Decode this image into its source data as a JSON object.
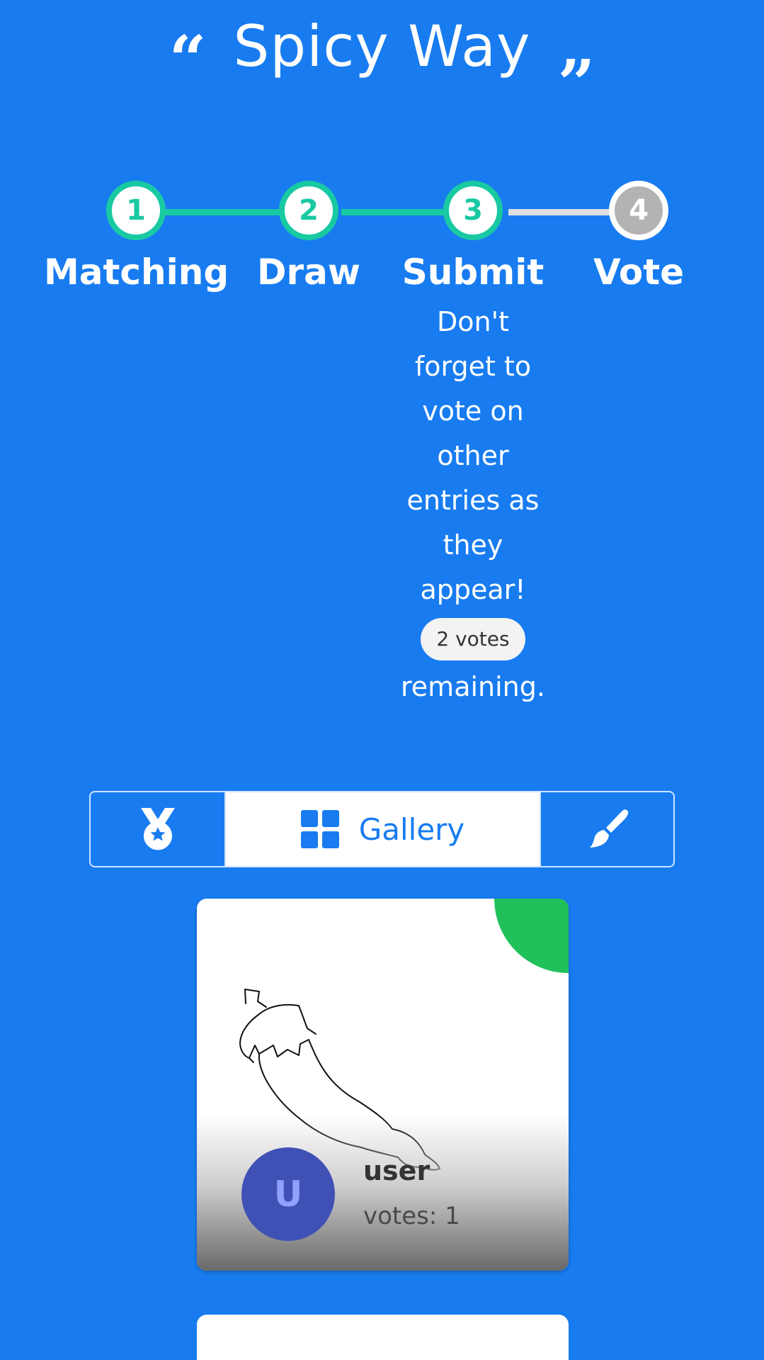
{
  "header": {
    "title": "Spicy Way",
    "open_quote": "“",
    "close_quote": "”"
  },
  "steps": [
    {
      "number": "1",
      "label": "Matching",
      "status": "done"
    },
    {
      "number": "2",
      "label": "Draw",
      "status": "done"
    },
    {
      "number": "3",
      "label": "Submit",
      "status": "done"
    },
    {
      "number": "4",
      "label": "Vote",
      "status": "todo"
    }
  ],
  "submit_notice": {
    "lines": [
      "Don't",
      "forget to",
      "vote on",
      "other",
      "entries as",
      "they",
      "appear!"
    ],
    "votes_badge": "2 votes",
    "suffix": "remaining."
  },
  "tabs": {
    "medal_icon": "medal-icon",
    "gallery_label": "Gallery",
    "gallery_icon": "grid-icon",
    "brush_icon": "paintbrush-icon",
    "active": "gallery"
  },
  "entries": [
    {
      "avatar_initial": "U",
      "author": "user",
      "votes": "votes: 1",
      "voted": true,
      "drawing": "chili-pepper-sketch"
    }
  ],
  "colors": {
    "background": "#187cf0",
    "step_done": "#18c9a2",
    "step_todo": "#b3b3b3",
    "voted_badge": "#20c15b",
    "avatar": "#3f51b5"
  }
}
